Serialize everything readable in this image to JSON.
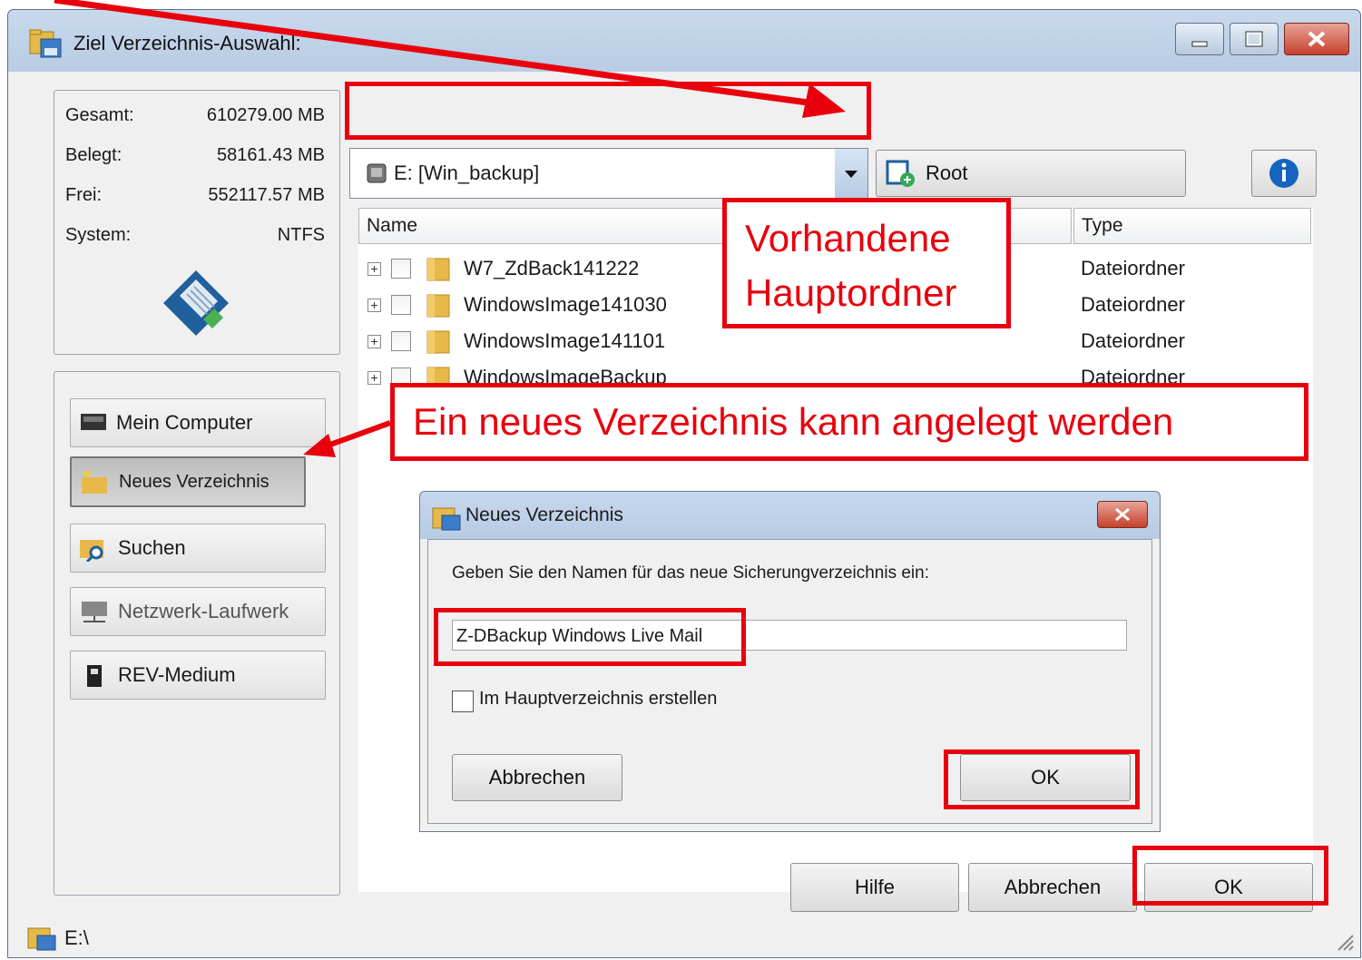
{
  "window": {
    "title": "Ziel Verzeichnis-Auswahl:"
  },
  "drive_info": {
    "rows": [
      {
        "label": "Gesamt:",
        "value": "610279.00 MB"
      },
      {
        "label": "Belegt:",
        "value": "58161.43 MB"
      },
      {
        "label": "Frei:",
        "value": "552117.57 MB"
      },
      {
        "label": "System:",
        "value": "NTFS"
      }
    ]
  },
  "sidebar": {
    "buttons": [
      {
        "label": "Mein Computer"
      },
      {
        "label": "Neues Verzeichnis"
      },
      {
        "label": "Suchen"
      },
      {
        "label": "Netzwerk-Laufwerk"
      },
      {
        "label": "REV-Medium"
      }
    ]
  },
  "drive_select": {
    "value": "E:  [Win_backup]"
  },
  "root_button": {
    "label": "Root"
  },
  "file_list": {
    "columns": [
      "Name",
      "Type"
    ],
    "rows": [
      {
        "name": "W7_ZdBack141222",
        "type": "Dateiordner"
      },
      {
        "name": "WindowsImage141030",
        "type": "Dateiordner"
      },
      {
        "name": "WindowsImage141101",
        "type": "Dateiordner"
      },
      {
        "name": "WindowsImageBackup",
        "type": "Dateiordner"
      }
    ],
    "expander": "+"
  },
  "annotations": {
    "existing_folders_line1": "Vorhandene",
    "existing_folders_line2": "Hauptordner",
    "new_dir_note": "Ein neues Verzeichnis kann angelegt werden"
  },
  "dialog": {
    "title": "Neues Verzeichnis",
    "prompt": "Geben Sie den Namen für das neue Sicherungverzeichnis ein:",
    "input_value": "Z-DBackup Windows Live Mail",
    "checkbox_label": "Im Hauptverzeichnis erstellen",
    "cancel_label": "Abbrechen",
    "ok_label": "OK"
  },
  "footer": {
    "help_label": "Hilfe",
    "cancel_label": "Abbrechen",
    "ok_label": "OK"
  },
  "status": {
    "path": "E:\\"
  },
  "colors": {
    "annotation_red": "#e8000d"
  }
}
